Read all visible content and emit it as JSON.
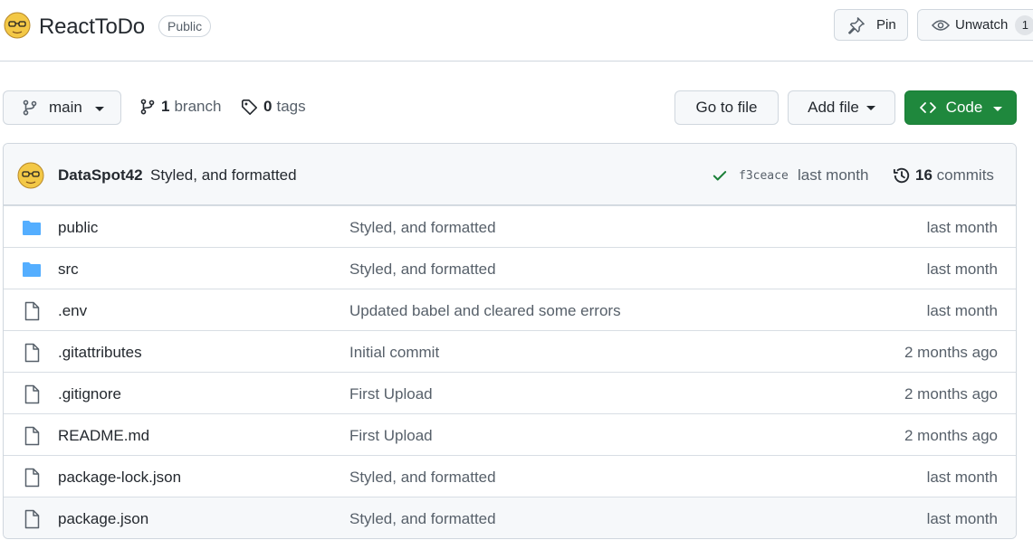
{
  "repo": {
    "name": "ReactToDo",
    "visibility": "Public",
    "pin_label": "Pin",
    "watch_label": "Unwatch",
    "watch_count": "1"
  },
  "toolbar": {
    "branch": "main",
    "branch_count": "1",
    "branch_label": "branch",
    "tag_count": "0",
    "tag_label": "tags",
    "goto_label": "Go to file",
    "addfile_label": "Add file",
    "code_label": "Code"
  },
  "latest_commit": {
    "author": "DataSpot42",
    "message": "Styled, and formatted",
    "sha": "f3ceace",
    "time": "last month",
    "commit_count": "16",
    "commit_label": "commits"
  },
  "files": [
    {
      "name": "public",
      "type": "folder",
      "commit": "Styled, and formatted",
      "age": "last month"
    },
    {
      "name": "src",
      "type": "folder",
      "commit": "Styled, and formatted",
      "age": "last month"
    },
    {
      "name": ".env",
      "type": "file",
      "commit": "Updated babel and cleared some errors",
      "age": "last month"
    },
    {
      "name": ".gitattributes",
      "type": "file",
      "commit": "Initial commit",
      "age": "2 months ago"
    },
    {
      "name": ".gitignore",
      "type": "file",
      "commit": "First Upload",
      "age": "2 months ago"
    },
    {
      "name": "README.md",
      "type": "file",
      "commit": "First Upload",
      "age": "2 months ago"
    },
    {
      "name": "package-lock.json",
      "type": "file",
      "commit": "Styled, and formatted",
      "age": "last month"
    },
    {
      "name": "package.json",
      "type": "file",
      "commit": "Styled, and formatted",
      "age": "last month"
    }
  ],
  "colors": {
    "folder": "#54aeff",
    "primary_button": "#1f883d",
    "success_check": "#1a7f37",
    "muted_text": "#57606a"
  },
  "icons": {
    "avatar": "avatar-icon",
    "pin": "pin-icon",
    "watch": "eye-icon",
    "branch": "git-branch-icon",
    "tag": "tag-icon",
    "code": "code-icon",
    "check": "check-icon",
    "history": "history-icon",
    "folder": "folder-icon",
    "file": "file-icon"
  }
}
